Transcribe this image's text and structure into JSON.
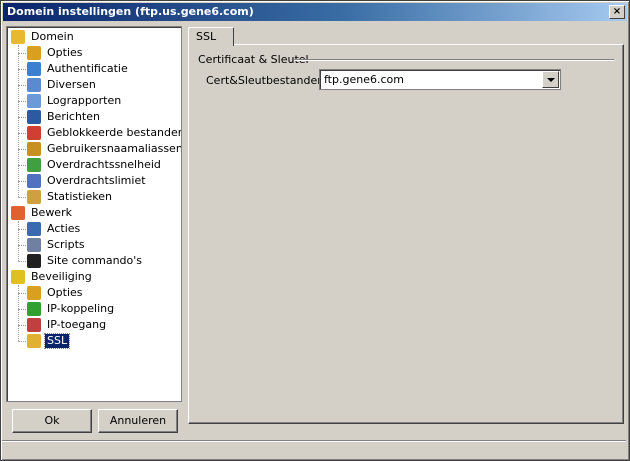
{
  "window": {
    "title": "Domein instellingen (ftp.us.gene6.com)",
    "close_label": "×"
  },
  "tree": {
    "groups": [
      {
        "label": "Domein",
        "icon": "domain-icon",
        "items": [
          {
            "label": "Opties",
            "icon": "options-icon"
          },
          {
            "label": "Authentificatie",
            "icon": "authentication-icon"
          },
          {
            "label": "Diversen",
            "icon": "misc-icon"
          },
          {
            "label": "Lograpporten",
            "icon": "log-icon"
          },
          {
            "label": "Berichten",
            "icon": "messages-icon"
          },
          {
            "label": "Geblokkeerde bestanden",
            "icon": "blocked-files-icon"
          },
          {
            "label": "Gebruikersnaamaliassen",
            "icon": "user-alias-icon"
          },
          {
            "label": "Overdrachtssnelheid",
            "icon": "transfer-speed-icon"
          },
          {
            "label": "Overdrachtslimiet",
            "icon": "transfer-limit-icon"
          },
          {
            "label": "Statistieken",
            "icon": "statistics-icon"
          }
        ]
      },
      {
        "label": "Bewerk",
        "icon": "edit-icon",
        "items": [
          {
            "label": "Acties",
            "icon": "actions-icon"
          },
          {
            "label": "Scripts",
            "icon": "scripts-icon"
          },
          {
            "label": "Site commando's",
            "icon": "site-command-icon"
          }
        ]
      },
      {
        "label": "Beveiliging",
        "icon": "security-icon",
        "items": [
          {
            "label": "Opties",
            "icon": "security-options-icon"
          },
          {
            "label": "IP-koppeling",
            "icon": "ip-binding-icon"
          },
          {
            "label": "IP-toegang",
            "icon": "ip-access-icon"
          },
          {
            "label": "SSL",
            "icon": "key-icon",
            "selected": true
          }
        ]
      }
    ]
  },
  "buttons": {
    "ok": "Ok",
    "cancel": "Annuleren"
  },
  "tab": {
    "label": "SSL"
  },
  "ssl": {
    "group_label": "Certificaat & Sleutel",
    "field_label": "Cert&Sleutbestanden",
    "selected_value": "ftp.gene6.com"
  }
}
